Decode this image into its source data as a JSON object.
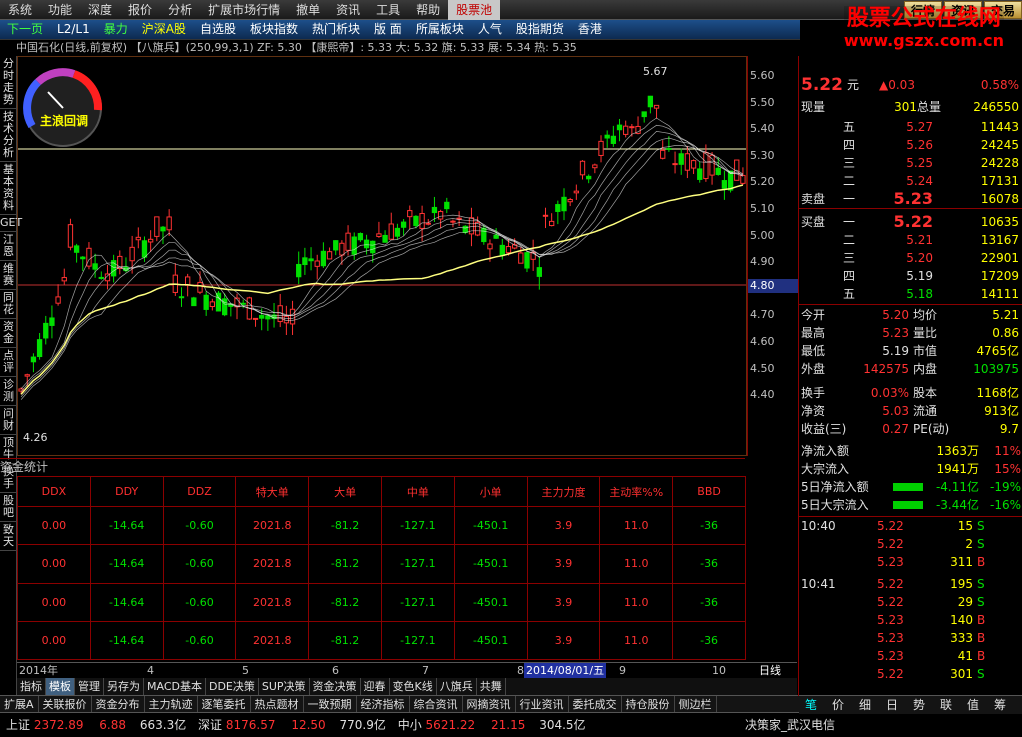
{
  "menu": {
    "items": [
      "系统",
      "功能",
      "深度",
      "报价",
      "分析",
      "扩展市场行情",
      "撤单",
      "资讯",
      "工具",
      "帮助",
      "股票池"
    ],
    "right": [
      "行情",
      "资讯",
      "交易"
    ]
  },
  "logo": {
    "line1": "股票公式在线网",
    "line2": "www.gszx.com.cn"
  },
  "secbar": [
    "下一页",
    "L2/L1",
    "暴力",
    "沪深A股",
    "自选股",
    "板块指数",
    "热门析块",
    "版  面",
    "所属板块",
    "人气",
    "股指期货",
    "香港"
  ],
  "chart_info": "中国石化(日线,前复权) 【八旗兵】(250,99,3,1)   ZF: 5.30 【康熙帝】: 5.33  大: 5.32  旗: 5.33  展: 5.34  热: 5.35",
  "gauge_label": "主浪回调",
  "price_hl": {
    "high": "5.67",
    "low": "4.26",
    "line": "4.80"
  },
  "colors": {
    "up": "#ff3232",
    "down": "#00e000",
    "bg": "#000000",
    "grid": "#8b0000"
  },
  "left_nav": [
    "分时走势",
    "技术分析",
    "基本资料",
    "GET",
    "江恩",
    "维赛",
    "同花",
    "资金",
    "点评",
    "诊测",
    "问财",
    "顶牛",
    "换手",
    "股吧",
    "致天"
  ],
  "fund": {
    "title": "资金统计",
    "headers": [
      "DDX",
      "DDY",
      "DDZ",
      "特大单",
      "大单",
      "中单",
      "小单",
      "主力力度",
      "主动率%%",
      "BBD"
    ],
    "rows": [
      [
        "0.00",
        "-14.64",
        "-0.60",
        "2021.8",
        "-81.2",
        "-127.1",
        "-450.1",
        "3.9",
        "11.0",
        "-36"
      ],
      [
        "0.00",
        "-14.64",
        "-0.60",
        "2021.8",
        "-81.2",
        "-127.1",
        "-450.1",
        "3.9",
        "11.0",
        "-36"
      ],
      [
        "0.00",
        "-14.64",
        "-0.60",
        "2021.8",
        "-81.2",
        "-127.1",
        "-450.1",
        "3.9",
        "11.0",
        "-36"
      ],
      [
        "0.00",
        "-14.64",
        "-0.60",
        "2021.8",
        "-81.2",
        "-127.1",
        "-450.1",
        "3.9",
        "11.0",
        "-36"
      ]
    ]
  },
  "dates": {
    "labels": [
      "2014年",
      "4",
      "5",
      "6",
      "7",
      "8",
      "9",
      "10"
    ],
    "current": "2014/08/01/五",
    "period": "日线"
  },
  "ind_tabs": [
    "指标",
    "模板",
    "管理",
    "另存为",
    "MACD基本",
    "DDE决策",
    "SUP决策",
    "资金决策",
    "迎春",
    "变色K线",
    "八旗兵",
    "共舞"
  ],
  "bottom_tabs": [
    "扩展A",
    "关联报价",
    "资金分布",
    "主力轨迹",
    "逐笔委托",
    "热点题材",
    "一致预期",
    "经济指标",
    "综合资讯",
    "网摘资讯",
    "行业资讯",
    "委托成交",
    "持仓股份",
    "侧边栏"
  ],
  "status": {
    "sh_name": "上证",
    "sh_val": "2372.89",
    "sh_chg": "6.88",
    "sh_amt": "663.3亿",
    "sz_name": "深证",
    "sz_val": "8176.57",
    "sz_chg": "12.50",
    "sz_amt": "770.9亿",
    "zx_name": "中小",
    "zx_val": "5621.22",
    "zx_chg": "21.15",
    "zx_amt": "304.5亿",
    "right": "决策家_武汉电信"
  },
  "yaxis": [
    "5.60",
    "5.50",
    "5.40",
    "5.30",
    "5.20",
    "5.10",
    "5.00",
    "4.90",
    "4.80",
    "4.70",
    "4.60",
    "4.50",
    "4.40"
  ],
  "quote": {
    "price": "5.22",
    "unit": "元",
    "chg": "▲0.03",
    "pct": "0.58%",
    "xianliang_label": "现量",
    "xianliang": "301",
    "zongliang_label": "总量",
    "zongliang": "246550",
    "asks": [
      [
        "五",
        "5.27",
        "11443"
      ],
      [
        "四",
        "5.26",
        "24245"
      ],
      [
        "三",
        "5.25",
        "24228"
      ],
      [
        "二",
        "5.24",
        "17131"
      ],
      [
        "一",
        "5.23",
        "16078"
      ]
    ],
    "ask_label": "卖盘",
    "bid_label": "买盘",
    "bids": [
      [
        "一",
        "5.22",
        "10635"
      ],
      [
        "二",
        "5.21",
        "13167"
      ],
      [
        "三",
        "5.20",
        "22901"
      ],
      [
        "四",
        "5.19",
        "17209"
      ],
      [
        "五",
        "5.18",
        "14111"
      ]
    ],
    "stats": [
      [
        "今开",
        "5.20",
        "均价",
        "5.21"
      ],
      [
        "最高",
        "5.23",
        "量比",
        "0.86"
      ],
      [
        "最低",
        "5.19",
        "市值",
        "4765亿"
      ],
      [
        "外盘",
        "142575",
        "内盘",
        "103975"
      ],
      [
        "换手",
        "0.03%",
        "股本",
        "1168亿"
      ],
      [
        "净资",
        "5.03",
        "流通",
        "913亿"
      ],
      [
        "收益(三)",
        "0.27",
        "PE(动)",
        "9.7"
      ]
    ],
    "flows": [
      [
        "净流入额",
        "1363万",
        "11%"
      ],
      [
        "大宗流入",
        "1941万",
        "15%"
      ],
      [
        "5日净流入额",
        "-4.11亿",
        "-19%"
      ],
      [
        "5日大宗流入",
        "-3.44亿",
        "-16%"
      ]
    ],
    "ticks": [
      [
        "10:40",
        "5.22",
        "15",
        "S"
      ],
      [
        "",
        "5.22",
        "2",
        "S"
      ],
      [
        "",
        "5.23",
        "311",
        "B"
      ],
      [
        "10:41",
        "5.22",
        "195",
        "S"
      ],
      [
        "",
        "5.22",
        "29",
        "S"
      ],
      [
        "",
        "5.23",
        "140",
        "B"
      ],
      [
        "",
        "5.23",
        "333",
        "B"
      ],
      [
        "",
        "5.23",
        "41",
        "B"
      ],
      [
        "",
        "5.22",
        "301",
        "S"
      ]
    ],
    "rtabs": [
      "笔",
      "价",
      "细",
      "日",
      "势",
      "联",
      "值",
      "筹"
    ]
  }
}
